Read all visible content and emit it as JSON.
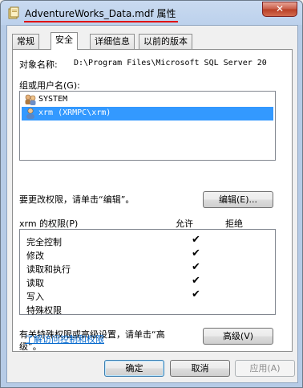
{
  "window": {
    "title": "AdventureWorks_Data.mdf 属性",
    "close_glyph": "✕"
  },
  "tabs": [
    {
      "label": "常规",
      "active": false
    },
    {
      "label": "安全",
      "active": true
    },
    {
      "label": "详细信息",
      "active": false
    },
    {
      "label": "以前的版本",
      "active": false
    }
  ],
  "security": {
    "object_name_label": "对象名称:",
    "object_name_value": "D:\\Program Files\\Microsoft SQL Server 20",
    "groups_label": "组或用户名(G):",
    "groups": [
      {
        "name": "SYSTEM",
        "icon": "users-group-icon",
        "selected": false
      },
      {
        "name": "xrm (XRMPC\\xrm)",
        "icon": "user-icon",
        "selected": true
      }
    ],
    "change_perm_text": "要更改权限，请单击“编辑”。",
    "edit_button": "编辑(E)...",
    "perm_header": "xrm 的权限(P)",
    "allow_header": "允许",
    "deny_header": "拒绝",
    "check_glyph": "✔",
    "permissions": [
      {
        "name": "完全控制",
        "allow": true,
        "deny": false
      },
      {
        "name": "修改",
        "allow": true,
        "deny": false
      },
      {
        "name": "读取和执行",
        "allow": true,
        "deny": false
      },
      {
        "name": "读取",
        "allow": true,
        "deny": false
      },
      {
        "name": "写入",
        "allow": true,
        "deny": false
      },
      {
        "name": "特殊权限",
        "allow": false,
        "deny": false
      }
    ],
    "advanced_text_line1": "有关特殊权限或高级设置，请单击“高",
    "advanced_text_line2": "级”。",
    "advanced_button": "高级(V)",
    "learn_link": "了解访问控制和权限"
  },
  "footer": {
    "ok": "确定",
    "cancel": "取消",
    "apply": "应用(A)"
  }
}
